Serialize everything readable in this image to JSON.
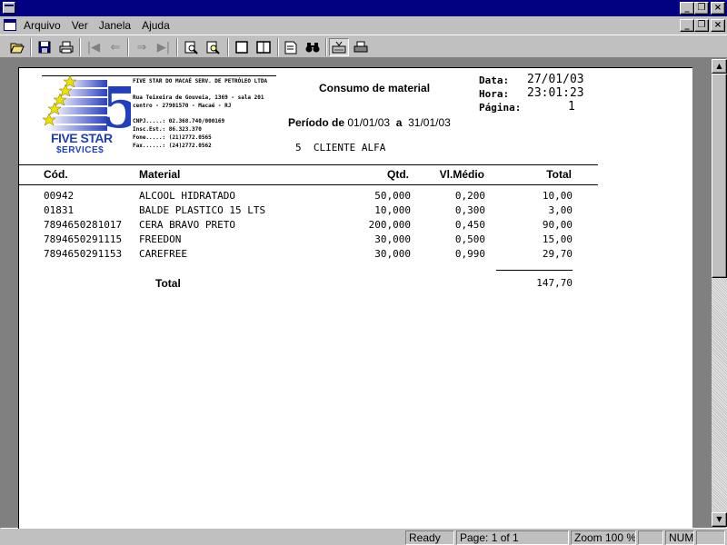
{
  "menu": {
    "items": [
      {
        "label": "Arquivo"
      },
      {
        "label": "Ver"
      },
      {
        "label": "Janela"
      },
      {
        "label": "Ajuda"
      }
    ]
  },
  "report": {
    "company_name": "FIVE STAR DO MACAÉ SERV. DE PETRÓLEO LTDA",
    "address_line1": "Rua Teixeira de Gouveia, 1369 - sala 201",
    "address_line2": "centro - 27901570 - Macaé - RJ",
    "cnpj": "CNPJ.....: 02.368.740/000169",
    "insc_est": "Insc.Est.: 86.323.370",
    "fone": "Fone.....: (21)2772.0565",
    "fax": "Fax......: (24)2772.0562",
    "logo_text": "FIVE STAR",
    "logo_sub": "$ERVICE$",
    "logo_number": "5",
    "title": "Consumo de material",
    "data_label": "Data:",
    "data_value": "27/01/03",
    "hora_label": "Hora:",
    "hora_value": "23:01:23",
    "pagina_label": "Página:",
    "pagina_value": "1",
    "periodo_label": "Período de",
    "periodo_from": "01/01/03",
    "periodo_sep": "a",
    "periodo_to": "31/01/03",
    "cliente_code": "5",
    "cliente_name": "CLIENTE ALFA",
    "columns": {
      "cod": "Cód.",
      "material": "Material",
      "qtd": "Qtd.",
      "vl_medio": "Vl.Médio",
      "total": "Total"
    },
    "rows": [
      {
        "cod": "00942",
        "material": "ALCOOL HIDRATADO",
        "qtd": "50,000",
        "vl_medio": "0,200",
        "total": "10,00"
      },
      {
        "cod": "01831",
        "material": "BALDE PLASTICO 15 LTS",
        "qtd": "10,000",
        "vl_medio": "0,300",
        "total": "3,00"
      },
      {
        "cod": "7894650281017",
        "material": "CERA BRAVO PRETO",
        "qtd": "200,000",
        "vl_medio": "0,450",
        "total": "90,00"
      },
      {
        "cod": "7894650291115",
        "material": "FREEDON",
        "qtd": "30,000",
        "vl_medio": "0,500",
        "total": "15,00"
      },
      {
        "cod": "7894650291153",
        "material": "CAREFREE",
        "qtd": "30,000",
        "vl_medio": "0,990",
        "total": "29,70"
      }
    ],
    "total_label": "Total",
    "total_value": "147,70"
  },
  "status": {
    "ready": "Ready",
    "page": "Page: 1 of 1",
    "zoom": "Zoom 100 %",
    "num": "NUM"
  },
  "colors": {
    "title_bar": "#000080",
    "chrome": "#c0c0c0",
    "client_bg": "#808080",
    "logo_blue": "#1f3fbf",
    "logo_star": "#f0e000"
  }
}
